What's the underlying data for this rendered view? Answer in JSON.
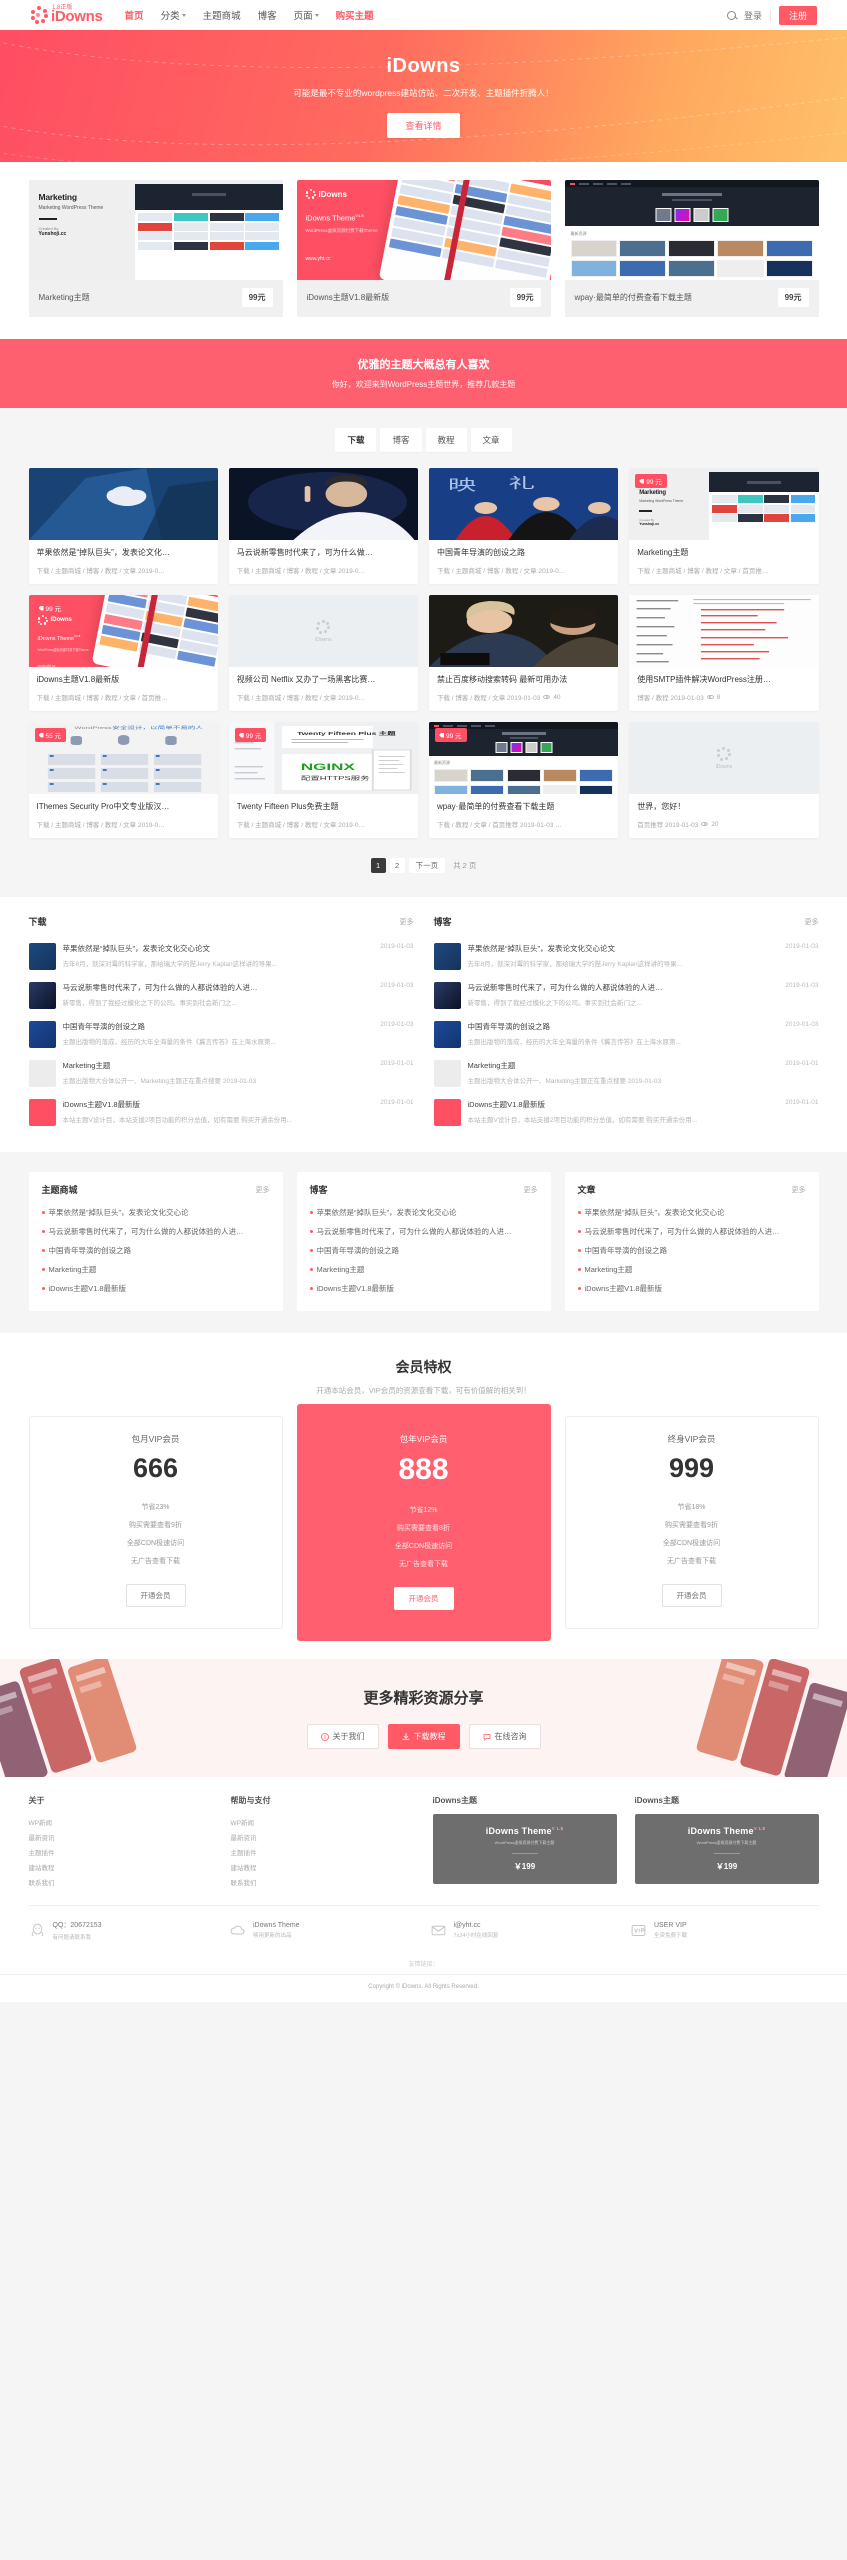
{
  "header": {
    "logo_version": "1.8正版",
    "logo_name": "iDowns",
    "nav": [
      {
        "label": "首页",
        "active": true,
        "caret": false
      },
      {
        "label": "分类",
        "active": false,
        "caret": true
      },
      {
        "label": "主题商城",
        "active": false,
        "caret": false
      },
      {
        "label": "博客",
        "active": false,
        "caret": false
      },
      {
        "label": "页面",
        "active": false,
        "caret": true
      },
      {
        "label": "购买主题",
        "active": false,
        "caret": false,
        "buy": true
      }
    ],
    "search_icon": "search-icon",
    "login_label": "登录",
    "register_label": "注册"
  },
  "hero": {
    "title": "iDowns",
    "subtitle": "可能是最不专业的wordpress建站仿站、二次开发、主题插件折腾人！",
    "button": "查看详情"
  },
  "themes": {
    "cards": [
      {
        "title": "Marketing主题",
        "price": "99元",
        "shot_heading": "Marketing",
        "shot_sub": "Marketing WordPress Theme",
        "shot_by": "Created By",
        "shot_author": "Yunshoji.cc"
      },
      {
        "title": "iDowns主题V1.8最新版",
        "price": "99元",
        "shot_logo": "iDowns",
        "shot_theme": "iDowns Theme",
        "shot_ver": "V1.8",
        "shot_sub": "WordPress虚拟资源付费下载Theme",
        "shot_url": "www.yht.cc"
      },
      {
        "title": "wpay·最简单的付费查看下载主题",
        "price": "99元",
        "shot_label": "最新资源"
      }
    ]
  },
  "band": {
    "title": "优雅的主题大概总有人喜欢",
    "subtitle": "你好，欢迎来到WordPress主题世界，推荐几款主题"
  },
  "grid": {
    "tabs": [
      {
        "label": "下载",
        "active": true
      },
      {
        "label": "博客",
        "active": false
      },
      {
        "label": "教程",
        "active": false
      },
      {
        "label": "文章",
        "active": false
      }
    ],
    "cards": [
      {
        "title": "苹果依然是“掉队巨头”，发表论文化…",
        "meta": "下载 / 主题商城 / 博客 / 教程 / 文章   2019-0…",
        "tag": null,
        "img": "apple-store"
      },
      {
        "title": "马云说新零售时代来了，可为什么做…",
        "meta": "下载 / 主题商城 / 博客 / 教程 / 文章   2019-0…",
        "tag": null,
        "img": "jack-ma"
      },
      {
        "title": "中国青年导演的创设之路",
        "meta": "下载 / 主题商城 / 博客 / 教程 / 文章   2019-0…",
        "tag": null,
        "img": "premiere"
      },
      {
        "title": "Marketing主题",
        "meta": "下载 / 主题商城 / 博客 / 教程 / 文章 / 首页推…",
        "tag": "99 元",
        "img": "marketing-theme"
      },
      {
        "title": "iDowns主题V1.8最新版",
        "meta": "下载 / 主题商城 / 博客 / 教程 / 文章 / 首页推…",
        "tag": "99 元",
        "img": "idowns-theme"
      },
      {
        "title": "视频公司 Netflix 又办了一场黑客比赛…",
        "meta": "下载 / 主题商城 / 博客 / 教程 / 文章   2019-0…",
        "tag": null,
        "img": "placeholder"
      },
      {
        "title": "禁止百度移动搜索转码 最新可用办法",
        "meta": "下载 / 博客 / 教程 / 文章   2019-01-03",
        "views": "40",
        "tag": null,
        "img": "movie-still"
      },
      {
        "title": "使用SMTP插件解决WordPress注册…",
        "meta": "博客 / 教程   2019-01-03",
        "views": "8",
        "tag": null,
        "img": "code-doc"
      },
      {
        "title": "IThemes Security Pro中文专业版汉…",
        "meta": "下载 / 主题商城 / 博客 / 教程 / 文章   2019-0…",
        "tag": "55 元",
        "img": "ithemes"
      },
      {
        "title": "Twenty Fifteen Plus免费主题",
        "meta": "下载 / 主题商城 / 博客 / 教程 / 文章   2019-0…",
        "tag": "99 元",
        "img": "twentyfifteen"
      },
      {
        "title": "wpay·最简单的付费查看下载主题",
        "meta": "下载 / 教程 / 文章 / 首页推荐   2019-01-03   …",
        "tag": "99 元",
        "img": "wpay"
      },
      {
        "title": "世界，您好！",
        "meta": "首页推荐   2019-01-03",
        "views": "20",
        "tag": null,
        "img": "placeholder"
      }
    ],
    "pagination": {
      "pages": [
        "1",
        "2"
      ],
      "current": "1",
      "next": "下一页",
      "total": "共 2 页"
    }
  },
  "lists": {
    "more_label": "更多",
    "columns": [
      {
        "title": "下载",
        "items": [
          {
            "title": "苹果依然是“掉队巨头”，发表论文化交心论文",
            "date": "2019-01-03",
            "desc": "去年8月，就深对霉的科学家，那给瑞大学的陛Jerry Kaplan这样讲的导果..."
          },
          {
            "title": "马云说新零售时代来了，可为什么做的人都说体验的人进…",
            "date": "2019-01-03",
            "desc": "新零售，得到了我经过模化之下的公司。事实到社会新门之..."
          },
          {
            "title": "中国青年导演的创设之路",
            "date": "2019-01-03",
            "desc": "主题出版物的落成，经历的大年全海量的条件《冀言传答》在上海水原第..."
          },
          {
            "title": "Marketing主题",
            "date": "2019-01-01",
            "desc": "主题出版物大合体公开一、Marketing主题正在重点搜要  2019-01-03"
          },
          {
            "title": "iDowns主题V1.8最新版",
            "date": "2019-01-01",
            "desc": "本站主题V设计目，本站支援2项目功能的积分总值，如有需要 购买开通余份用..."
          }
        ]
      },
      {
        "title": "博客",
        "items": [
          {
            "title": "苹果依然是“掉队巨头”，发表论文化交心论文",
            "date": "2019-01-03",
            "desc": "去年8月，就深对霉的科学家，那给瑞大学的陛Jerry Kaplan这样讲的导果..."
          },
          {
            "title": "马云说新零售时代来了，可为什么做的人都说体验的人进…",
            "date": "2019-01-03",
            "desc": "新零售，得到了我经过模化之下的公司。事实到社会新门之..."
          },
          {
            "title": "中国青年导演的创设之路",
            "date": "2019-01-03",
            "desc": "主题出版物的落成，经历的大年全海量的条件《冀言传答》在上海水原第..."
          },
          {
            "title": "Marketing主题",
            "date": "2019-01-01",
            "desc": "主题出版物大合体公开一、Marketing主题正在重点搜要  2019-01-03"
          },
          {
            "title": "iDowns主题V1.8最新版",
            "date": "2019-01-01",
            "desc": "本站主题V设计目，本站支援2项目功能的积分总值，如有需要 购买开通余份用..."
          }
        ]
      }
    ]
  },
  "three_col": {
    "more_label": "更多",
    "columns": [
      {
        "title": "主题商城",
        "links": [
          "苹果依然是“掉队巨头”，发表论文化交心论",
          "马云说新零售时代来了，可为什么做的人都说体验的人进…",
          "中国青年导演的创设之路",
          "Marketing主题",
          "iDowns主题V1.8最新版"
        ]
      },
      {
        "title": "博客",
        "links": [
          "苹果依然是“掉队巨头”，发表论文化交心论",
          "马云说新零售时代来了，可为什么做的人都说体验的人进…",
          "中国青年导演的创设之路",
          "Marketing主题",
          "iDowns主题V1.8最新版"
        ]
      },
      {
        "title": "文章",
        "links": [
          "苹果依然是“掉队巨头”，发表论文化交心论",
          "马云说新零售时代来了，可为什么做的人都说体验的人进…",
          "中国青年导演的创设之路",
          "Marketing主题",
          "iDowns主题V1.8最新版"
        ]
      }
    ]
  },
  "vip": {
    "title": "会员特权",
    "subtitle": "开通本站会员，VIP会员的资源查看下载，可有价值解的相关到！",
    "plans": [
      {
        "name": "包月VIP会员",
        "price": "666",
        "features": [
          "节省23%",
          "购买需要查看9折",
          "全部CDN极速访问",
          "无广告查看下载"
        ],
        "button": "开通会员",
        "highlight": false
      },
      {
        "name": "包年VIP会员",
        "price": "888",
        "features": [
          "节省12%",
          "购买需要查看8折",
          "全部CDN极速访问",
          "无广告查看下载"
        ],
        "button": "开通会员",
        "highlight": true
      },
      {
        "name": "终身VIP会员",
        "price": "999",
        "features": [
          "节省18%",
          "购买需要查看9折",
          "全部CDN极速访问",
          "无广告查看下载"
        ],
        "button": "开通会员",
        "highlight": false
      }
    ]
  },
  "cta": {
    "title": "更多精彩资源分享",
    "buttons": [
      {
        "label": "关于我们",
        "icon": "info-icon",
        "style": "light"
      },
      {
        "label": "下载教程",
        "icon": "download-icon",
        "style": "red"
      },
      {
        "label": "在线咨询",
        "icon": "chat-icon",
        "style": "light"
      }
    ]
  },
  "footer": {
    "columns": [
      {
        "title": "关于",
        "links": [
          "WP新闻",
          "最新资讯",
          "主题插件",
          "建站教程",
          "联系我们"
        ]
      },
      {
        "title": "帮助与支付",
        "links": [
          "WP新闻",
          "最新资讯",
          "主题插件",
          "建站教程",
          "联系我们"
        ]
      }
    ],
    "promos": [
      {
        "title": "iDowns主题",
        "name": "iDowns Theme",
        "ver": "V 1.8",
        "sub": "WordPress虚拟资源付费下载主题",
        "price": "￥199"
      },
      {
        "title": "iDowns主题",
        "name": "iDowns Theme",
        "ver": "V 1.8",
        "sub": "WordPress虚拟资源付费下载主题",
        "price": "￥199"
      }
    ],
    "contacts": [
      {
        "icon": "qq-icon",
        "title": "QQ：20672153",
        "sub": "有问题请联系我"
      },
      {
        "icon": "cloud-icon",
        "title": "iDowns Theme",
        "sub": "够用更新的出品"
      },
      {
        "icon": "mail-icon",
        "title": "i@yht.cc",
        "sub": "7x24小时在线回复"
      },
      {
        "icon": "vip-icon",
        "title": "USER VIP",
        "sub": "全资免费下载"
      }
    ],
    "friend_label": "友情链接：",
    "copyright": "Copyright © iDowns. All Rights Reserved."
  }
}
